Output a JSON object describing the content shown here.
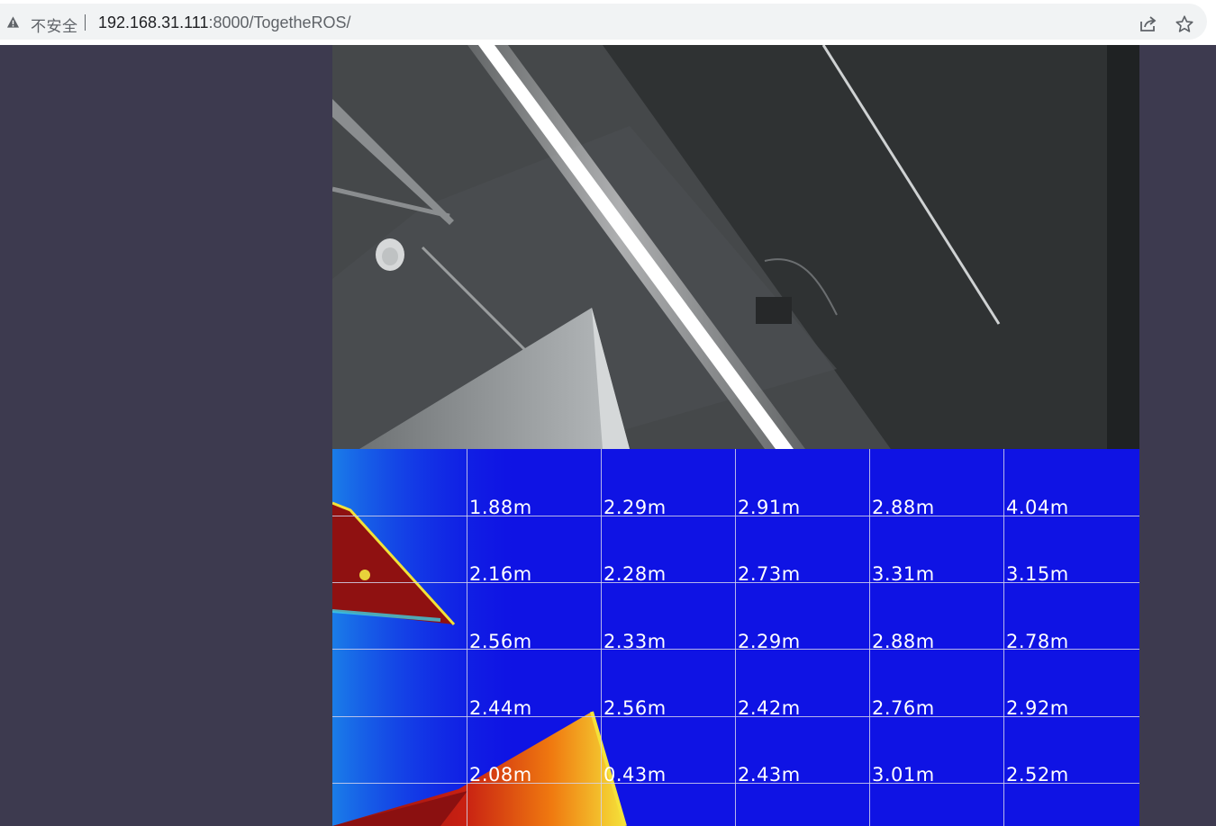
{
  "browser": {
    "security_label": "不安全",
    "url_host": "192.168.31.111",
    "url_path": ":8000/TogetheROS/",
    "icons": {
      "warning": "warning-triangle-icon",
      "share": "share-icon",
      "bookmark": "star-icon"
    }
  },
  "depth_grid": {
    "rows": [
      [
        "1.88m",
        "2.29m",
        "2.91m",
        "2.88m",
        "4.04m"
      ],
      [
        "2.16m",
        "2.28m",
        "2.73m",
        "3.31m",
        "3.15m"
      ],
      [
        "2.56m",
        "2.33m",
        "2.29m",
        "2.88m",
        "2.78m"
      ],
      [
        "2.44m",
        "2.56m",
        "2.42m",
        "2.76m",
        "2.92m"
      ],
      [
        "2.08m",
        "0.43m",
        "2.43m",
        "3.01m",
        "2.52m"
      ]
    ]
  }
}
